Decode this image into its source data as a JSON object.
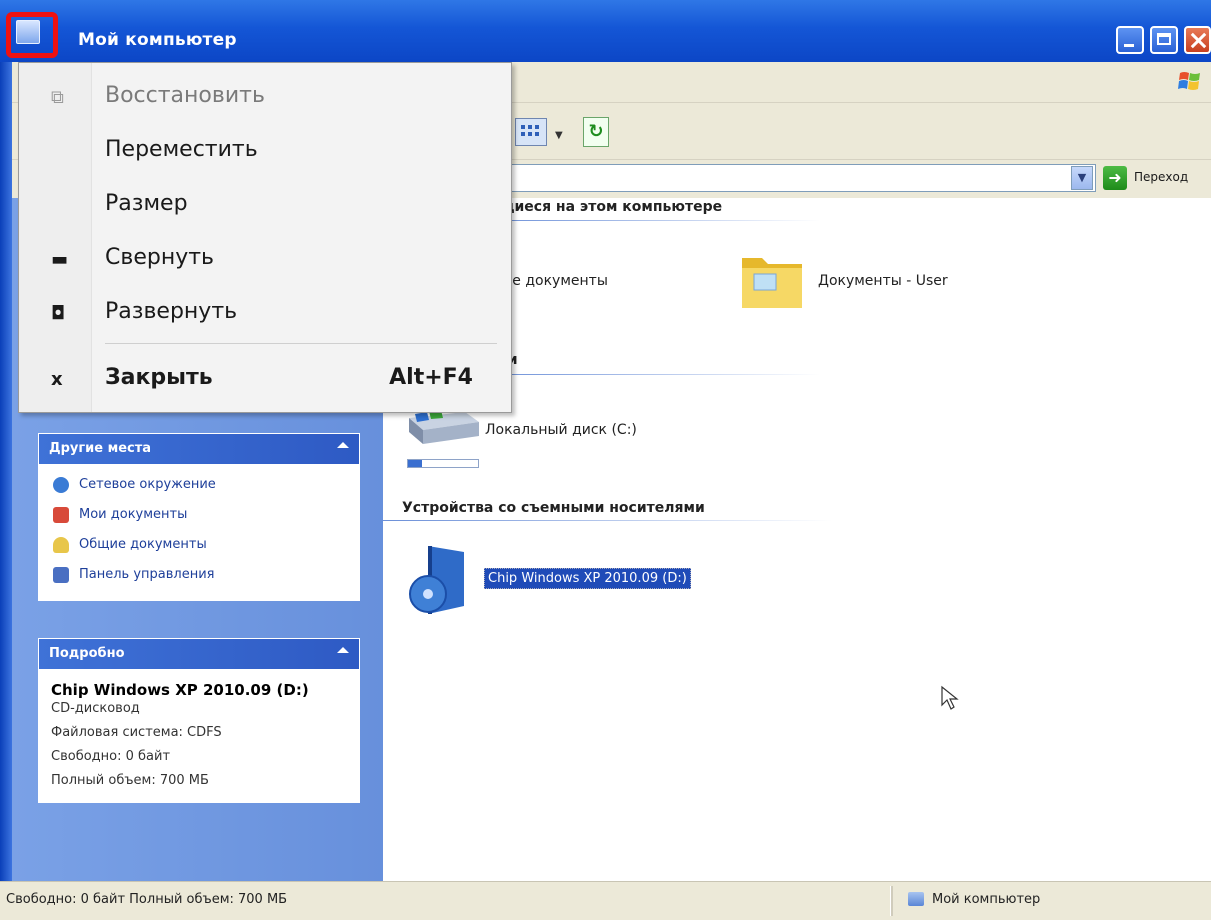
{
  "window": {
    "title": "Мой компьютер"
  },
  "toolbar": {
    "go_label": "Переход"
  },
  "content": {
    "section_files_partial": "ящиеся на этом компьютере",
    "shared_docs_partial": "щие документы",
    "user_docs": "Документы - User",
    "section_disks_partial": "ски",
    "local_disk": "Локальный диск (C:)",
    "local_disk_usage_fraction": 0.2,
    "section_removable": "Устройства со съемными носителями",
    "cd_label": "Chip Windows XP 2010.09 (D:)"
  },
  "sidebar": {
    "other_places": {
      "title": "Другие места",
      "items": [
        {
          "label": "Сетевое окружение",
          "icon": "network-icon",
          "color": "#3a7bd5"
        },
        {
          "label": "Мои документы",
          "icon": "my-documents-icon",
          "color": "#d84a3a"
        },
        {
          "label": "Общие документы",
          "icon": "shared-folder-icon",
          "color": "#e8c64a"
        },
        {
          "label": "Панель управления",
          "icon": "control-panel-icon",
          "color": "#4a6fc2"
        }
      ]
    },
    "details": {
      "title": "Подробно",
      "name": "Chip Windows XP 2010.09 (D:)",
      "type": "CD-дисковод",
      "filesystem": "Файловая система: CDFS",
      "free": "Свободно: 0 байт",
      "total": "Полный объем: 700 МБ"
    }
  },
  "system_menu": {
    "items": [
      {
        "label": "Восстановить",
        "glyph": "restore-icon",
        "enabled": false
      },
      {
        "label": "Переместить",
        "glyph": "",
        "enabled": true
      },
      {
        "label": "Размер",
        "glyph": "",
        "enabled": true
      },
      {
        "label": "Свернуть",
        "glyph": "minimize-icon",
        "enabled": true
      },
      {
        "label": "Развернуть",
        "glyph": "maximize-icon",
        "enabled": true
      },
      {
        "label": "Закрыть",
        "glyph": "close-icon",
        "enabled": true,
        "shortcut": "Alt+F4"
      }
    ],
    "glyphs": {
      "restore": "⧉",
      "minimize": "▬",
      "maximize": "◘",
      "close": "x"
    }
  },
  "statusbar": {
    "left": "Свободно: 0 байт Полный объем: 700 МБ",
    "right": "Мой компьютер"
  },
  "colors": {
    "title_blue": "#1456d6",
    "highlight_red": "#ee1111",
    "selection_blue": "#1f4bb8"
  }
}
